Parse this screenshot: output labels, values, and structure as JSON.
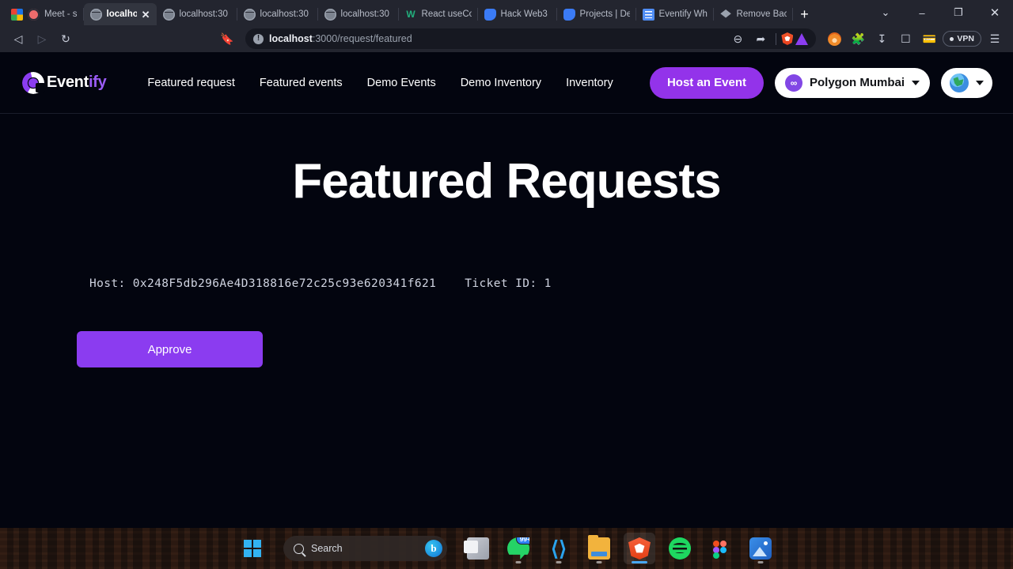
{
  "browser": {
    "tabs": [
      {
        "label": "Meet - s",
        "favicon": "google-meet-icon",
        "active": false
      },
      {
        "label": "localhos",
        "favicon": "globe-icon",
        "active": true
      },
      {
        "label": "localhost:30",
        "favicon": "globe-icon",
        "active": false
      },
      {
        "label": "localhost:30",
        "favicon": "globe-icon",
        "active": false
      },
      {
        "label": "localhost:30",
        "favicon": "globe-icon",
        "active": false
      },
      {
        "label": "React useCo",
        "favicon": "w-icon",
        "active": false
      },
      {
        "label": "Hack Web3",
        "favicon": "blue-doc-icon",
        "active": false
      },
      {
        "label": "Projects | De",
        "favicon": "blue-doc-icon",
        "active": false
      },
      {
        "label": "Eventify Wh",
        "favicon": "blue-notes-icon",
        "active": false
      },
      {
        "label": "Remove Bac",
        "favicon": "layers-icon",
        "active": false
      }
    ],
    "new_tab_label": "+",
    "window_controls": {
      "expand": "⌄",
      "minimize": "–",
      "maximize": "❐",
      "close": "✕"
    },
    "toolbar": {
      "back": "◁",
      "forward": "▷",
      "reload": "↻",
      "bookmark": "🔖",
      "url_host": "localhost",
      "url_path": ":3000/request/featured",
      "warning_glyph": "!",
      "zoom_out": "⊖",
      "share": "➦",
      "brave_shields": "brave-shield-icon",
      "brave_rewards": "brave-rewards-icon",
      "metamask": "metamask-fox-icon",
      "extensions": "puzzle-icon",
      "downloads": "download-icon",
      "sidebar": "sidebar-icon",
      "wallet": "wallet-icon",
      "vpn_label": "VPN",
      "menu": "☰"
    }
  },
  "site": {
    "logo": {
      "name_white": "Event",
      "name_purple": "ify"
    },
    "nav_links": [
      "Featured request",
      "Featured events",
      "Demo Events",
      "Demo Inventory",
      "Inventory"
    ],
    "host_button": "Host an Event",
    "network_pill": {
      "icon": "polygon-icon",
      "label": "Polygon Mumbai"
    },
    "account_pill": {
      "icon": "globe-icon"
    }
  },
  "main": {
    "title": "Featured Requests",
    "request": {
      "host_label": "Host: 0x248F5db296Ae4D318816e72c25c93e620341f621",
      "ticket_label": "Ticket ID: 1"
    },
    "approve_button": "Approve"
  },
  "taskbar": {
    "start": "windows-start-icon",
    "search_placeholder": "Search",
    "bing_glyph": "b",
    "apps": [
      {
        "name": "task-view",
        "badge": ""
      },
      {
        "name": "whatsapp",
        "badge": "99+"
      },
      {
        "name": "vscode",
        "badge": ""
      },
      {
        "name": "file-explorer",
        "badge": ""
      },
      {
        "name": "brave-browser",
        "badge": ""
      },
      {
        "name": "spotify",
        "badge": ""
      },
      {
        "name": "figma",
        "badge": ""
      },
      {
        "name": "photos",
        "badge": ""
      }
    ]
  },
  "colors": {
    "accent_purple": "#8b3cf6",
    "host_button": "#9333ea",
    "page_bg": "#03050f",
    "browser_chrome": "#23252f"
  }
}
